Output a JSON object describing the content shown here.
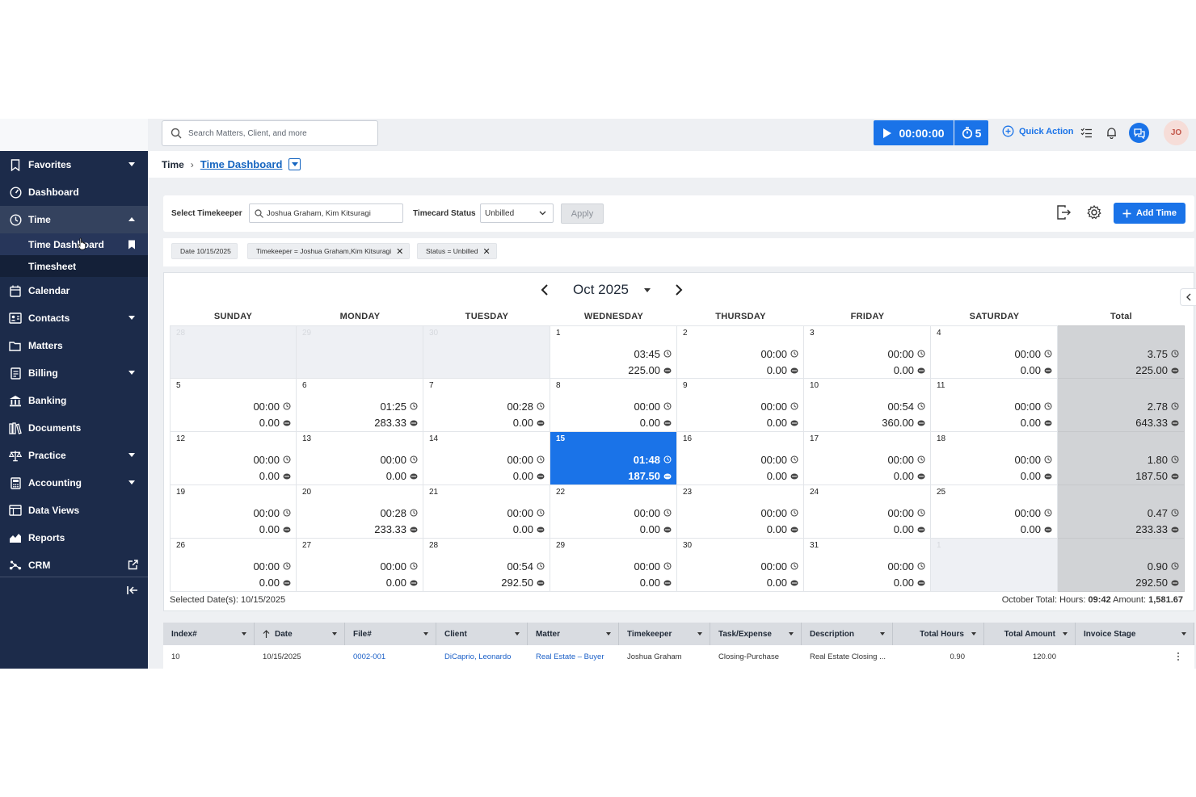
{
  "search": {
    "placeholder": "Search Matters, Client, and more"
  },
  "timer": {
    "time": "00:00:00",
    "count": "5"
  },
  "header": {
    "quick_action": "Quick Action",
    "avatar": "JO"
  },
  "sidebar": {
    "items": [
      {
        "label": "Favorites",
        "icon": "bookmark-icon"
      },
      {
        "label": "Dashboard",
        "icon": "dashboard-icon"
      },
      {
        "label": "Time",
        "icon": "clock-icon"
      },
      {
        "label": "Calendar",
        "icon": "calendar-icon"
      },
      {
        "label": "Contacts",
        "icon": "contacts-icon"
      },
      {
        "label": "Matters",
        "icon": "folder-icon"
      },
      {
        "label": "Billing",
        "icon": "billing-icon"
      },
      {
        "label": "Banking",
        "icon": "bank-icon"
      },
      {
        "label": "Documents",
        "icon": "documents-icon"
      },
      {
        "label": "Practice",
        "icon": "scale-icon"
      },
      {
        "label": "Accounting",
        "icon": "calculator-icon"
      },
      {
        "label": "Data Views",
        "icon": "table-icon"
      },
      {
        "label": "Reports",
        "icon": "reports-icon"
      },
      {
        "label": "CRM",
        "icon": "crm-icon"
      }
    ],
    "time_sub": [
      "Time Dashboard",
      "Timesheet"
    ]
  },
  "breadcrumb": {
    "root": "Time",
    "current": "Time Dashboard"
  },
  "filters": {
    "timekeeper_label": "Select Timekeeper",
    "timekeeper_value": "Joshua Graham, Kim Kitsuragi",
    "status_label": "Timecard Status",
    "status_value": "Unbilled",
    "apply": "Apply",
    "add_time": "Add Time"
  },
  "chips": [
    {
      "text": "Date 10/15/2025"
    },
    {
      "text": "Timekeeper = Joshua Graham,Kim Kitsuragi"
    },
    {
      "text": "Status = Unbilled"
    }
  ],
  "calendar": {
    "month_label": "Oct 2025",
    "weekdays": [
      "SUNDAY",
      "MONDAY",
      "TUESDAY",
      "WEDNESDAY",
      "THURSDAY",
      "FRIDAY",
      "SATURDAY",
      "Total"
    ],
    "weeks": [
      {
        "days": [
          {
            "d": "28",
            "other": true
          },
          {
            "d": "29",
            "other": true
          },
          {
            "d": "30",
            "other": true
          },
          {
            "d": "1",
            "h": "03:45",
            "a": "225.00"
          },
          {
            "d": "2",
            "h": "00:00",
            "a": "0.00"
          },
          {
            "d": "3",
            "h": "00:00",
            "a": "0.00"
          },
          {
            "d": "4",
            "h": "00:00",
            "a": "0.00"
          }
        ],
        "total": {
          "h": "3.75",
          "a": "225.00"
        }
      },
      {
        "days": [
          {
            "d": "5",
            "h": "00:00",
            "a": "0.00"
          },
          {
            "d": "6",
            "h": "01:25",
            "a": "283.33"
          },
          {
            "d": "7",
            "h": "00:28",
            "a": "0.00"
          },
          {
            "d": "8",
            "h": "00:00",
            "a": "0.00"
          },
          {
            "d": "9",
            "h": "00:00",
            "a": "0.00"
          },
          {
            "d": "10",
            "h": "00:54",
            "a": "360.00"
          },
          {
            "d": "11",
            "h": "00:00",
            "a": "0.00"
          }
        ],
        "total": {
          "h": "2.78",
          "a": "643.33"
        }
      },
      {
        "days": [
          {
            "d": "12",
            "h": "00:00",
            "a": "0.00"
          },
          {
            "d": "13",
            "h": "00:00",
            "a": "0.00"
          },
          {
            "d": "14",
            "h": "00:00",
            "a": "0.00"
          },
          {
            "d": "15",
            "h": "01:48",
            "a": "187.50",
            "selected": true
          },
          {
            "d": "16",
            "h": "00:00",
            "a": "0.00"
          },
          {
            "d": "17",
            "h": "00:00",
            "a": "0.00"
          },
          {
            "d": "18",
            "h": "00:00",
            "a": "0.00"
          }
        ],
        "total": {
          "h": "1.80",
          "a": "187.50"
        }
      },
      {
        "days": [
          {
            "d": "19",
            "h": "00:00",
            "a": "0.00"
          },
          {
            "d": "20",
            "h": "00:28",
            "a": "233.33"
          },
          {
            "d": "21",
            "h": "00:00",
            "a": "0.00"
          },
          {
            "d": "22",
            "h": "00:00",
            "a": "0.00"
          },
          {
            "d": "23",
            "h": "00:00",
            "a": "0.00"
          },
          {
            "d": "24",
            "h": "00:00",
            "a": "0.00"
          },
          {
            "d": "25",
            "h": "00:00",
            "a": "0.00"
          }
        ],
        "total": {
          "h": "0.47",
          "a": "233.33"
        }
      },
      {
        "days": [
          {
            "d": "26",
            "h": "00:00",
            "a": "0.00"
          },
          {
            "d": "27",
            "h": "00:00",
            "a": "0.00"
          },
          {
            "d": "28",
            "h": "00:54",
            "a": "292.50"
          },
          {
            "d": "29",
            "h": "00:00",
            "a": "0.00"
          },
          {
            "d": "30",
            "h": "00:00",
            "a": "0.00"
          },
          {
            "d": "31",
            "h": "00:00",
            "a": "0.00"
          },
          {
            "d": "1",
            "other": true
          }
        ],
        "total": {
          "h": "0.90",
          "a": "292.50"
        }
      }
    ],
    "footer": {
      "selected_label": "Selected Date(s):",
      "selected_value": "10/15/2025",
      "total_label": "October Total:",
      "hours_label": "Hours:",
      "hours_value": "09:42",
      "amount_label": "Amount:",
      "amount_value": "1,581.67"
    }
  },
  "table": {
    "columns": [
      "Index#",
      "Date",
      "File#",
      "Client",
      "Matter",
      "Timekeeper",
      "Task/Expense",
      "Description",
      "Total Hours",
      "Total Amount",
      "Invoice Stage"
    ],
    "rows": [
      [
        "10",
        "10/15/2025",
        "0002-001",
        "DiCaprio, Leonardo",
        "Real Estate – Buyer",
        "Joshua Graham",
        "Closing-Purchase",
        "Real Estate Closing ...",
        "0.90",
        "120.00",
        ""
      ]
    ]
  },
  "colors": {
    "accent": "#1a73e8",
    "sidebar": "#1c2b4a",
    "total_col": "#d1d3d6"
  }
}
